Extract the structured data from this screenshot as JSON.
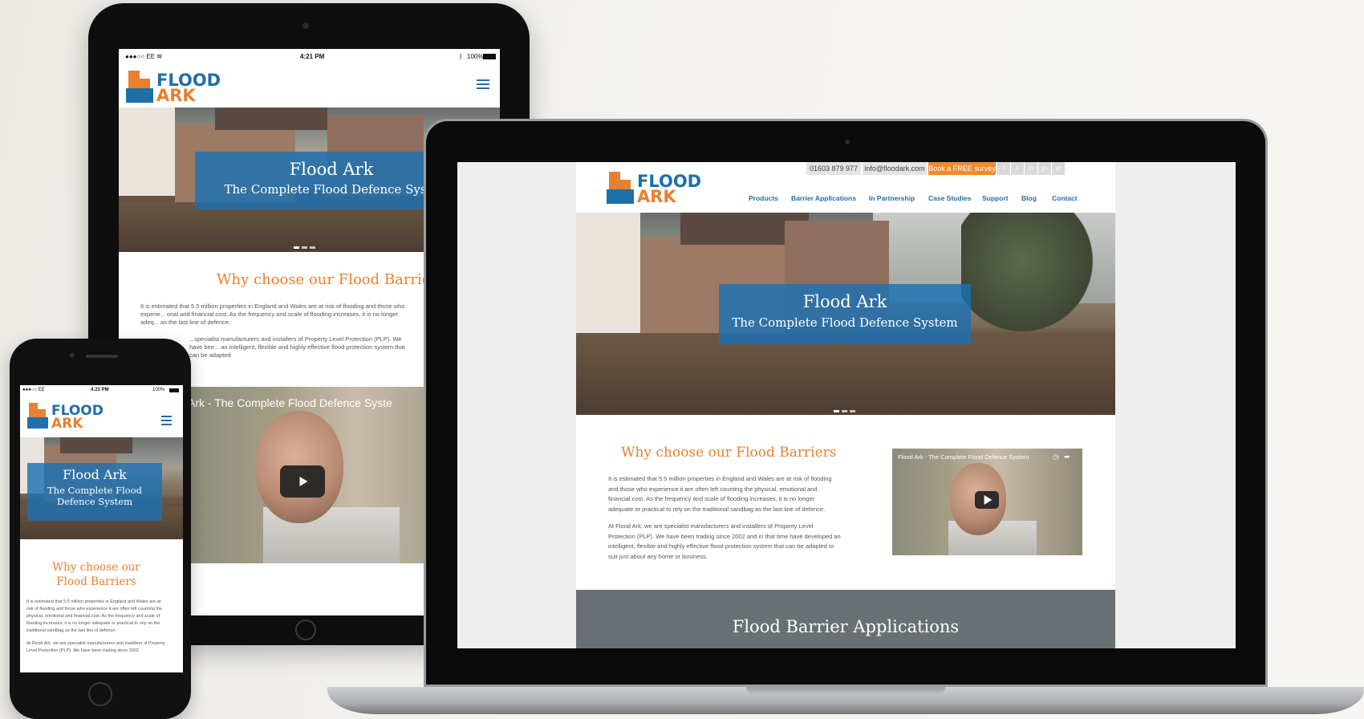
{
  "site": {
    "logo_line1": "FLOOD",
    "logo_line2": "ARK",
    "hero_title": "Flood Ark",
    "hero_subtitle": "The Complete Flood Defence System",
    "hero_subtitle_tablet": "The Complete Flood Defence Syste",
    "phone_subtitle_line1": "The Complete Flood",
    "phone_subtitle_line2": "Defence System",
    "why_heading": "Why choose our Flood Barriers",
    "why_heading_tablet": "Why choose our Flood Barrie",
    "phone_heading_line1": "Why choose our",
    "phone_heading_line2": "Flood Barriers",
    "para1": "It is estimated that 5.5 million properties in England and Wales are at risk of flooding and those who experience it are often left counting the physical, emotional and financial cost. As the frequency and scale of flooding increases, it is no longer adequate or practical to rely on the traditional sandbag as the last line of defence.",
    "para2": "At Flood Ark, we are specialist manufacturers and installers of Property Level Protection (PLP). We have been trading since 2002 and in that time have developed an intelligent, flexible and highly effective flood protection system that can be adapted to suit just about any home or business.",
    "tablet_para1": "It is estimated that 5.5 million properties in England and Wales are at risk of flooding and those who experie... onal and financial cost. As the frequency and scale of flooding increases, it is no longer adeq... as the last line of defence.",
    "tablet_para2": "...specialist manufacturers and installers of Property Level Protection (PLP). We have bee... an intelligent, flexible and highly effective flood protection system that can be adapted",
    "phone_para1": "It is estimated that 5.5 million properties in England and Wales are at risk of flooding and those who experience it are often left counting the physical, emotional and financial cost. As the frequency and scale of flooding increases, it is no longer adequate or practical to rely on the traditional sandbag as the last line of defence.",
    "phone_para2": "At Flood Ark, we are specialist manufacturers and installers of Property Level Protection (PLP). We have been trading since 2002",
    "video_title": "Flood Ark - The Complete Flood Defence System",
    "video_title_tablet": "Ark - The Complete Flood Defence Syste",
    "applications_heading": "Flood Barrier Applications"
  },
  "topbar": {
    "phone": "01603 879 977",
    "email": "info@floodark.com",
    "cta": "Book a FREE survey",
    "social": [
      "f",
      "t",
      "in",
      "g+",
      "yt"
    ]
  },
  "nav": {
    "items": [
      "Products",
      "Barrier Applications",
      "In Partnership",
      "Case Studies",
      "Support",
      "Blog",
      "Contact"
    ]
  },
  "tablet_status": {
    "carrier": "●●●○○ EE",
    "time": "4:21 PM",
    "battery": "100%"
  },
  "phone_status": {
    "carrier": "●●●○○ EE",
    "time": "4:21 PM",
    "battery": "100%"
  },
  "colors": {
    "brand_blue": "#1f6fa8",
    "brand_orange": "#e8802f",
    "cta_orange": "#f28a2e",
    "footer_band": "#687073"
  },
  "icons": [
    "hamburger-menu-icon",
    "play-icon",
    "clock-icon",
    "share-icon",
    "wifi-icon",
    "battery-icon",
    "bluetooth-icon"
  ]
}
